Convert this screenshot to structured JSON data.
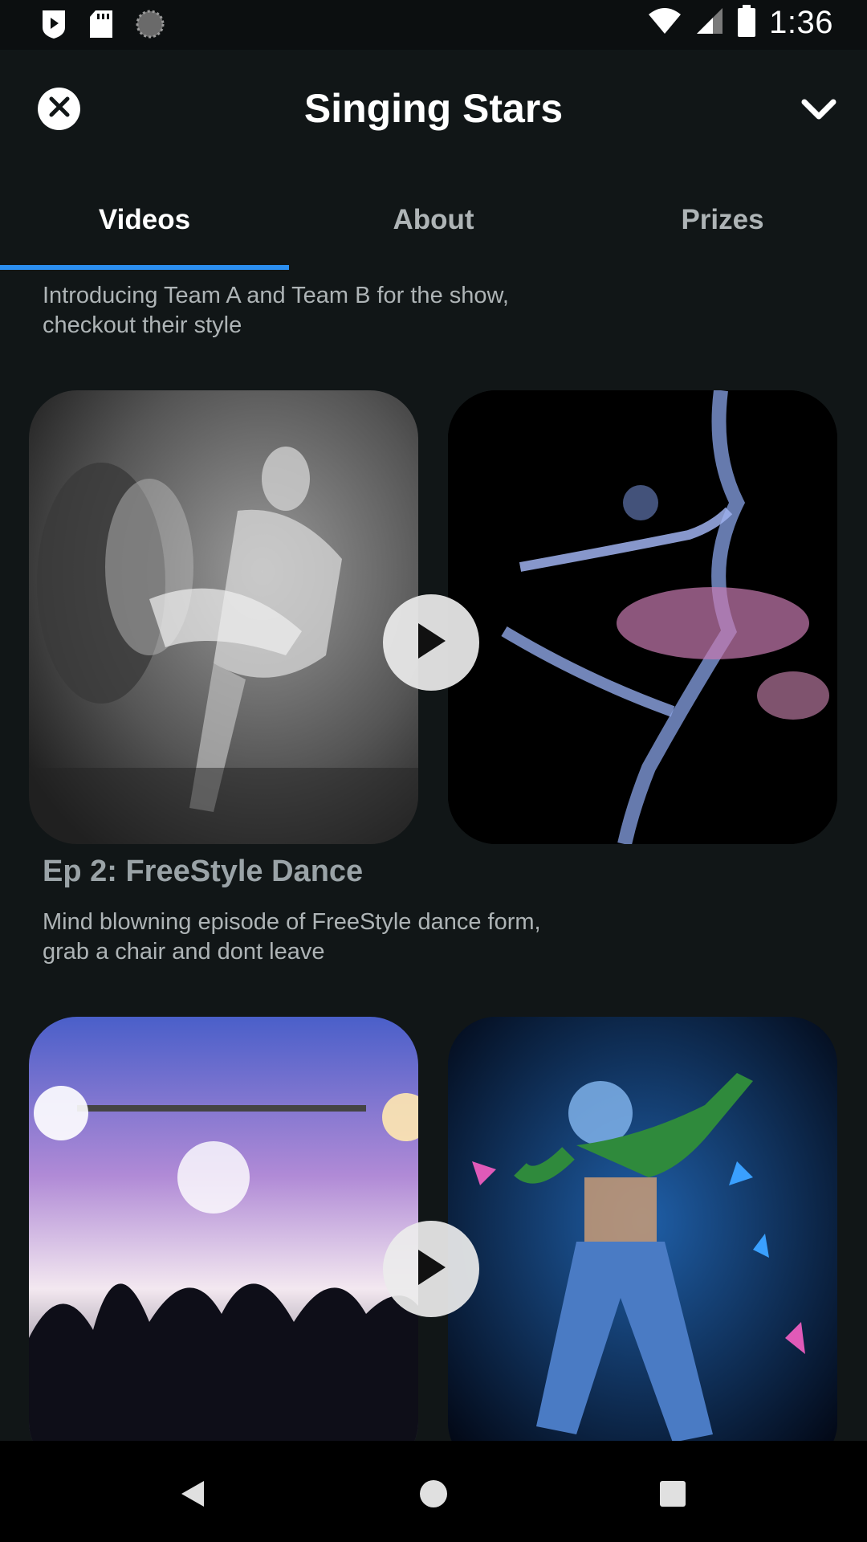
{
  "status_bar": {
    "time": "1:36",
    "left_icons": [
      "play-shield-icon",
      "sd-card-icon",
      "loading-circle-icon"
    ],
    "right_icons": [
      "wifi-icon",
      "signal-icon",
      "battery-icon"
    ]
  },
  "app_bar": {
    "title": "Singing Stars",
    "close_icon": "close-circle-icon",
    "expand_icon": "chevron-down-icon"
  },
  "tabs": [
    {
      "label": "Videos",
      "active": true
    },
    {
      "label": "About",
      "active": false
    },
    {
      "label": "Prizes",
      "active": false
    }
  ],
  "episodes": [
    {
      "title": "",
      "description": "Introducing Team A and Team B for the show, checkout their style",
      "thumbnails": [
        "couple-dance-bw-image",
        "smoke-dancer-image"
      ]
    },
    {
      "title": "Ep 2: FreeStyle Dance",
      "description": "Mind blowning episode of FreeStyle dance form, grab a chair and dont leave",
      "thumbnails": [
        "concert-crowd-image",
        "neon-hiphop-dancer-image"
      ]
    }
  ],
  "nav_bar": {
    "back_icon": "back-triangle-icon",
    "home_icon": "home-circle-icon",
    "recents_icon": "recents-square-icon"
  },
  "colors": {
    "background": "#111617",
    "accent": "#2c8ff0",
    "muted_text": "#aeb4b6"
  }
}
